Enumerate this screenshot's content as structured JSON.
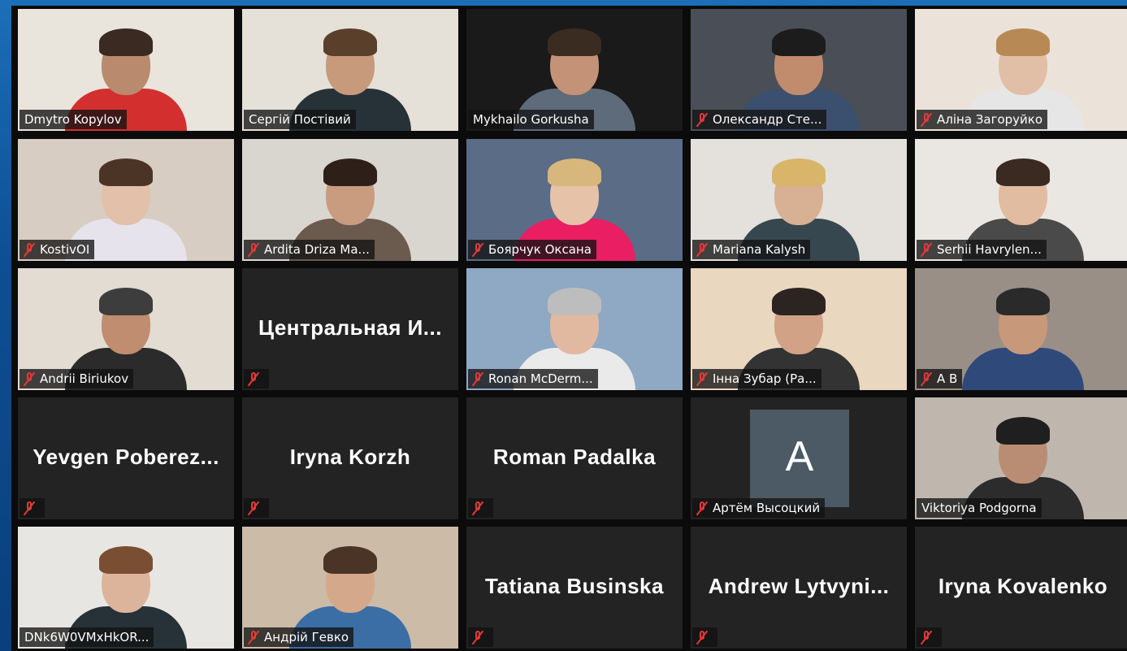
{
  "participants": [
    {
      "name": "Dmytro Kopylov",
      "muted": false,
      "active": false,
      "bg": "#e9e4dc",
      "skin": "#b98a6e",
      "hair": "#3a2a22",
      "shirt": "#d32f2f"
    },
    {
      "name": "Сергій Постівий",
      "muted": false,
      "active": false,
      "bg": "#e5e1d8",
      "skin": "#c79a7c",
      "hair": "#5a3f2a",
      "shirt": "#263238"
    },
    {
      "name": "Mykhailo Gorkusha",
      "muted": false,
      "active": true,
      "bg": "#1a1a1a",
      "skin": "#c49276",
      "hair": "#3b2c22",
      "shirt": "#5d6b7a"
    },
    {
      "name": "Олександр Сте...",
      "muted": true,
      "active": false,
      "bg": "#4a4f57",
      "skin": "#c18b6e",
      "hair": "#1c1c1c",
      "shirt": "#3b4f6e"
    },
    {
      "name": "Аліна Загоруйко",
      "muted": true,
      "active": false,
      "bg": "#ebe3da",
      "skin": "#e1bfa7",
      "hair": "#b78a55",
      "shirt": "#e6e6e6"
    },
    {
      "name": "KostivOI",
      "muted": true,
      "active": false,
      "bg": "#d8cdc2",
      "skin": "#e2c0a9",
      "hair": "#4b3426",
      "shirt": "#e6e3ec"
    },
    {
      "name": "Ardita Driza Ma...",
      "muted": true,
      "active": false,
      "bg": "#d9d6cf",
      "skin": "#c99c80",
      "hair": "#2e2019",
      "shirt": "#6b5a4e"
    },
    {
      "name": "Боярчук Оксана",
      "muted": true,
      "active": false,
      "bg": "#5a6c86",
      "skin": "#e5c2a8",
      "hair": "#d7b77b",
      "shirt": "#e91e63"
    },
    {
      "name": "Mariana Kalysh",
      "muted": true,
      "active": false,
      "bg": "#e4e1dc",
      "skin": "#d8b093",
      "hair": "#d9b56a",
      "shirt": "#37474f"
    },
    {
      "name": "Serhii Havrylen...",
      "muted": true,
      "active": false,
      "bg": "#eae7e2",
      "skin": "#e2bca0",
      "hair": "#3a2a22",
      "shirt": "#4a4a4a"
    },
    {
      "name": "Andrii Biriukov",
      "muted": true,
      "active": false,
      "bg": "#e3dcd2",
      "skin": "#c08d70",
      "hair": "#3d3d3d",
      "shirt": "#2b2b2b"
    },
    {
      "name": "Центральная И...",
      "muted": true,
      "active": false,
      "placeholder": true
    },
    {
      "name": "Ronan McDerm...",
      "muted": true,
      "active": false,
      "bg": "#8fa8c4",
      "skin": "#e0b9a0",
      "hair": "#bdbdbd",
      "shirt": "#eaeaea"
    },
    {
      "name": "Інна Зубар (Ра...",
      "muted": true,
      "active": false,
      "bg": "#ead7c0",
      "skin": "#d1a285",
      "hair": "#2c2420",
      "shirt": "#333333"
    },
    {
      "name": "A B",
      "muted": true,
      "active": false,
      "bg": "#9a8f87",
      "skin": "#c8987a",
      "hair": "#2a2a2a",
      "shirt": "#2f4a7a"
    },
    {
      "name": "Yevgen  Poberez...",
      "muted": true,
      "active": false,
      "placeholder": true
    },
    {
      "name": "Iryna Korzh",
      "muted": true,
      "active": false,
      "placeholder": true
    },
    {
      "name": "Roman Padalka",
      "muted": true,
      "active": false,
      "placeholder": true
    },
    {
      "name": "Артём Высоцкий",
      "muted": true,
      "active": false,
      "avatar_letter": "A"
    },
    {
      "name": "Viktoriya Podgorna",
      "muted": false,
      "active": false,
      "bg": "#bfb7ae",
      "skin": "#b98d74",
      "hair": "#1f1f1f",
      "shirt": "#2c2c2c"
    },
    {
      "name": "DNk6W0VMxHkOR...",
      "muted": false,
      "active": false,
      "bg": "#e8e6e3",
      "skin": "#dcb49c",
      "hair": "#7a4e33",
      "shirt": "#263238"
    },
    {
      "name": "Андрій Гевко",
      "muted": true,
      "active": false,
      "bg": "#cbbba7",
      "skin": "#d4a88a",
      "hair": "#4a3426",
      "shirt": "#3b6ea5"
    },
    {
      "name": "Tatiana Businska",
      "muted": true,
      "active": false,
      "placeholder": true
    },
    {
      "name": "Andrew  Lytvyni...",
      "muted": true,
      "active": false,
      "placeholder": true
    },
    {
      "name": "Iryna Kovalenko",
      "muted": true,
      "active": false,
      "placeholder": true
    }
  ]
}
